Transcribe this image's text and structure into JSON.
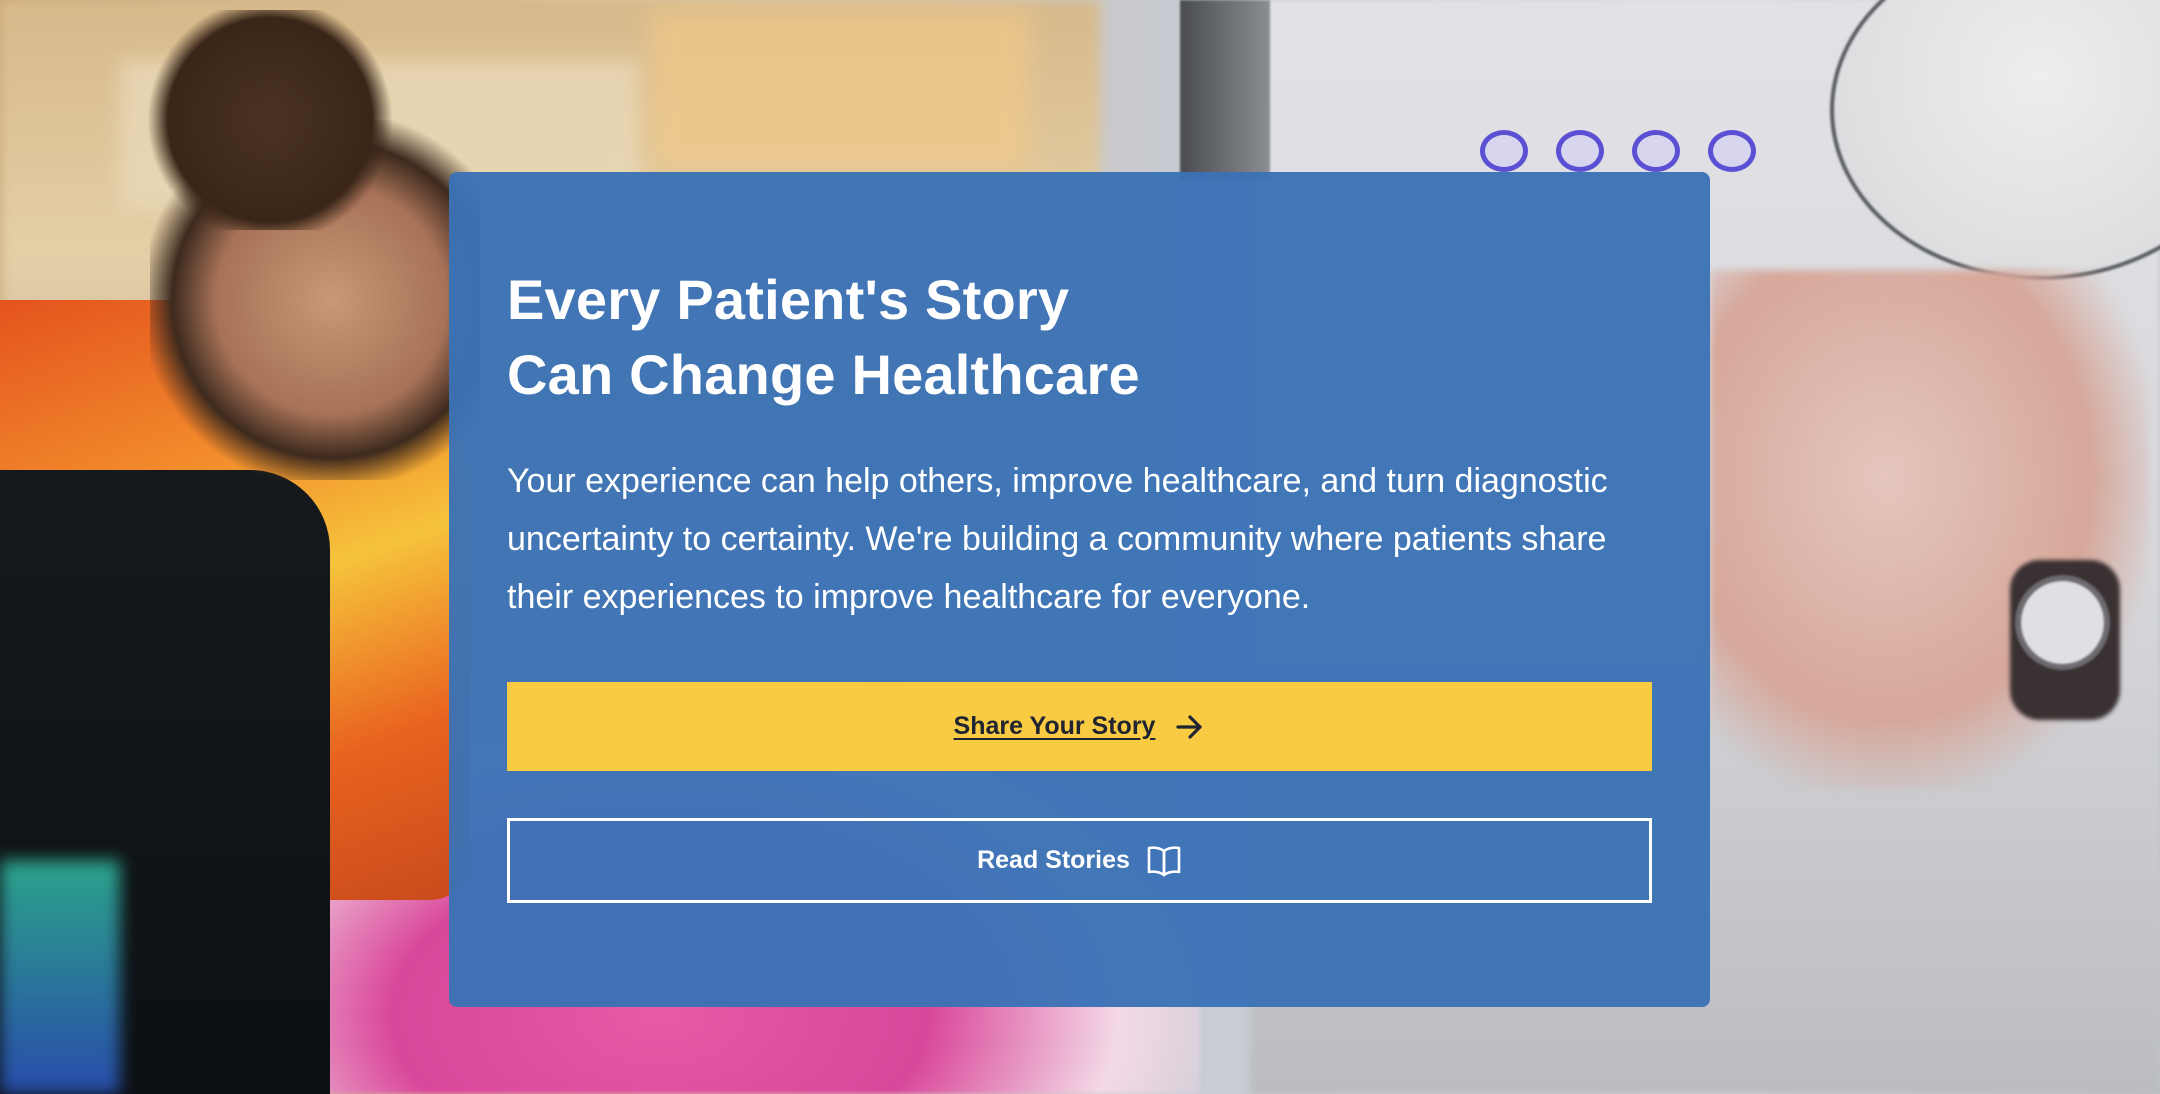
{
  "hero": {
    "title_line_1": "Every Patient's Story",
    "title_line_2": "Can Change Healthcare",
    "description": "Your experience can help others, improve healthcare, and turn diagnostic uncertainty to certainty. We're building a community where patients share their experiences to improve healthcare for everyone.",
    "primary_button": {
      "label": "Share Your Story",
      "icon": "arrow-right-icon"
    },
    "secondary_button": {
      "label": "Read Stories",
      "icon": "open-book-icon"
    }
  },
  "colors": {
    "card_background": "#3a71b5",
    "primary_button": "#f8cb43",
    "primary_button_text": "#1f2430",
    "text_on_card": "#ffffff"
  }
}
